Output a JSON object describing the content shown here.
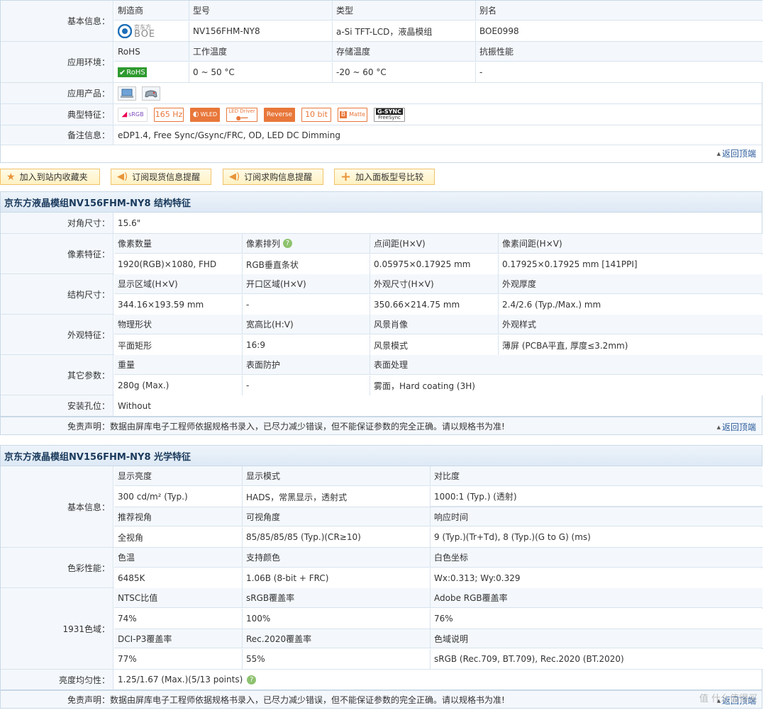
{
  "top": {
    "basic": {
      "label": "基本信息：",
      "headers": [
        "制造商",
        "型号",
        "类型",
        "别名"
      ],
      "values": [
        "",
        "NV156FHM-NY8",
        "a-Si TFT-LCD，液晶模组",
        "BOE0998"
      ],
      "logo_text_cn": "京东方",
      "logo_text_en": "BOE"
    },
    "env": {
      "label": "应用环境：",
      "headers": [
        "RoHS",
        "工作温度",
        "存储温度",
        "抗振性能"
      ],
      "values": [
        "RoHS",
        "0 ~ 50 °C",
        "-20 ~ 60 °C",
        "-"
      ]
    },
    "products": {
      "label": "应用产品：",
      "icons": [
        "laptop-icon",
        "gamepad-icon"
      ]
    },
    "features": {
      "label": "典型特征：",
      "badges": [
        "sRGB",
        "165 Hz",
        "WLED",
        "LED Driver",
        "Reverse",
        "10 bit",
        "Matte",
        "G-SYNC",
        "FreeSync"
      ]
    },
    "remark": {
      "label": "备注信息：",
      "value": "eDP1.4, Free Sync/Gsync/FRC, OD, LED DC Dimming"
    },
    "back_top": "返回顶端"
  },
  "actions": [
    {
      "label": "加入到站内收藏夹",
      "icon": "star-icon"
    },
    {
      "label": "订阅现货信息提醒",
      "icon": "speaker-icon"
    },
    {
      "label": "订阅求购信息提醒",
      "icon": "speaker-icon"
    },
    {
      "label": "加入面板型号比较",
      "icon": "plus-icon"
    }
  ],
  "structure": {
    "title": "京东方液晶模组NV156FHM-NY8 结构特征",
    "diagonal": {
      "label": "对角尺寸：",
      "value": "15.6\""
    },
    "pixel": {
      "label": "像素特征：",
      "headers": [
        "像素数量",
        "像素排列",
        "点间距(H×V)",
        "像素间距(H×V)"
      ],
      "values": [
        "1920(RGB)×1080, FHD",
        "RGB垂直条状",
        "0.05975×0.17925 mm",
        "0.17925×0.17925 mm  [141PPI]"
      ]
    },
    "size": {
      "label": "结构尺寸：",
      "headers": [
        "显示区域(H×V)",
        "开口区域(H×V)",
        "外观尺寸(H×V)",
        "外观厚度"
      ],
      "values": [
        "344.16×193.59 mm",
        "-",
        "350.66×214.75 mm",
        "2.4/2.6 (Typ./Max.) mm"
      ]
    },
    "appearance": {
      "label": "外观特征：",
      "headers": [
        "物理形状",
        "宽高比(H:V)",
        "风景肖像",
        "外观样式"
      ],
      "values": [
        "平面矩形",
        "16:9",
        "风景模式",
        "薄屏 (PCBA平直, 厚度≤3.2mm)"
      ]
    },
    "other": {
      "label": "其它参数：",
      "headers": [
        "重量",
        "表面防护",
        "表面处理"
      ],
      "values": [
        "280g (Max.)",
        "-",
        "雾面，Hard coating (3H)"
      ]
    },
    "mount": {
      "label": "安装孔位：",
      "value": "Without"
    },
    "disclaimer": "免责声明：数据由屏库电子工程师依据规格书录入，已尽力减少错误，但不能保证参数的完全正确。请以规格书为准!",
    "back_top": "返回顶端"
  },
  "optical": {
    "title": "京东方液晶模组NV156FHM-NY8 光学特征",
    "basic": {
      "label": "基本信息：",
      "headers1": [
        "显示亮度",
        "显示模式",
        "对比度"
      ],
      "values1": [
        "300 cd/m² (Typ.)",
        "HADS，常黑显示，透射式",
        "1000:1 (Typ.) (透射)"
      ],
      "headers2": [
        "推荐视角",
        "可视角度",
        "响应时间"
      ],
      "values2": [
        "全视角",
        "85/85/85/85 (Typ.)(CR≥10)",
        "9 (Typ.)(Tr+Td), 8 (Typ.)(G to G) (ms)"
      ]
    },
    "color": {
      "label": "色彩性能：",
      "headers": [
        "色温",
        "支持颜色",
        "白色坐标"
      ],
      "values": [
        "6485K",
        "1.06B (8-bit + FRC)",
        "Wx:0.313; Wy:0.329"
      ]
    },
    "gamut": {
      "label": "1931色域：",
      "headers1": [
        "NTSC比值",
        "sRGB覆盖率",
        "Adobe RGB覆盖率"
      ],
      "values1": [
        "74%",
        "100%",
        "76%"
      ],
      "headers2": [
        "DCI-P3覆盖率",
        "Rec.2020覆盖率",
        "色域说明"
      ],
      "values2": [
        "77%",
        "55%",
        "sRGB (Rec.709, BT.709), Rec.2020 (BT.2020)"
      ]
    },
    "uniformity": {
      "label": "亮度均匀性：",
      "value": "1.25/1.67 (Max.)(5/13 points)"
    },
    "disclaimer": "免责声明：数据由屏库电子工程师依据规格书录入，已尽力减少错误，但不能保证参数的完全正确。请以规格书为准!",
    "back_top": "返回顶端"
  },
  "watermark": "值 什么值得买",
  "colors": {
    "accent": "#1a3a5c",
    "border": "#c9d8e6",
    "label_bg": "#f4f8fc",
    "rohs_green": "#2e9a2e"
  }
}
